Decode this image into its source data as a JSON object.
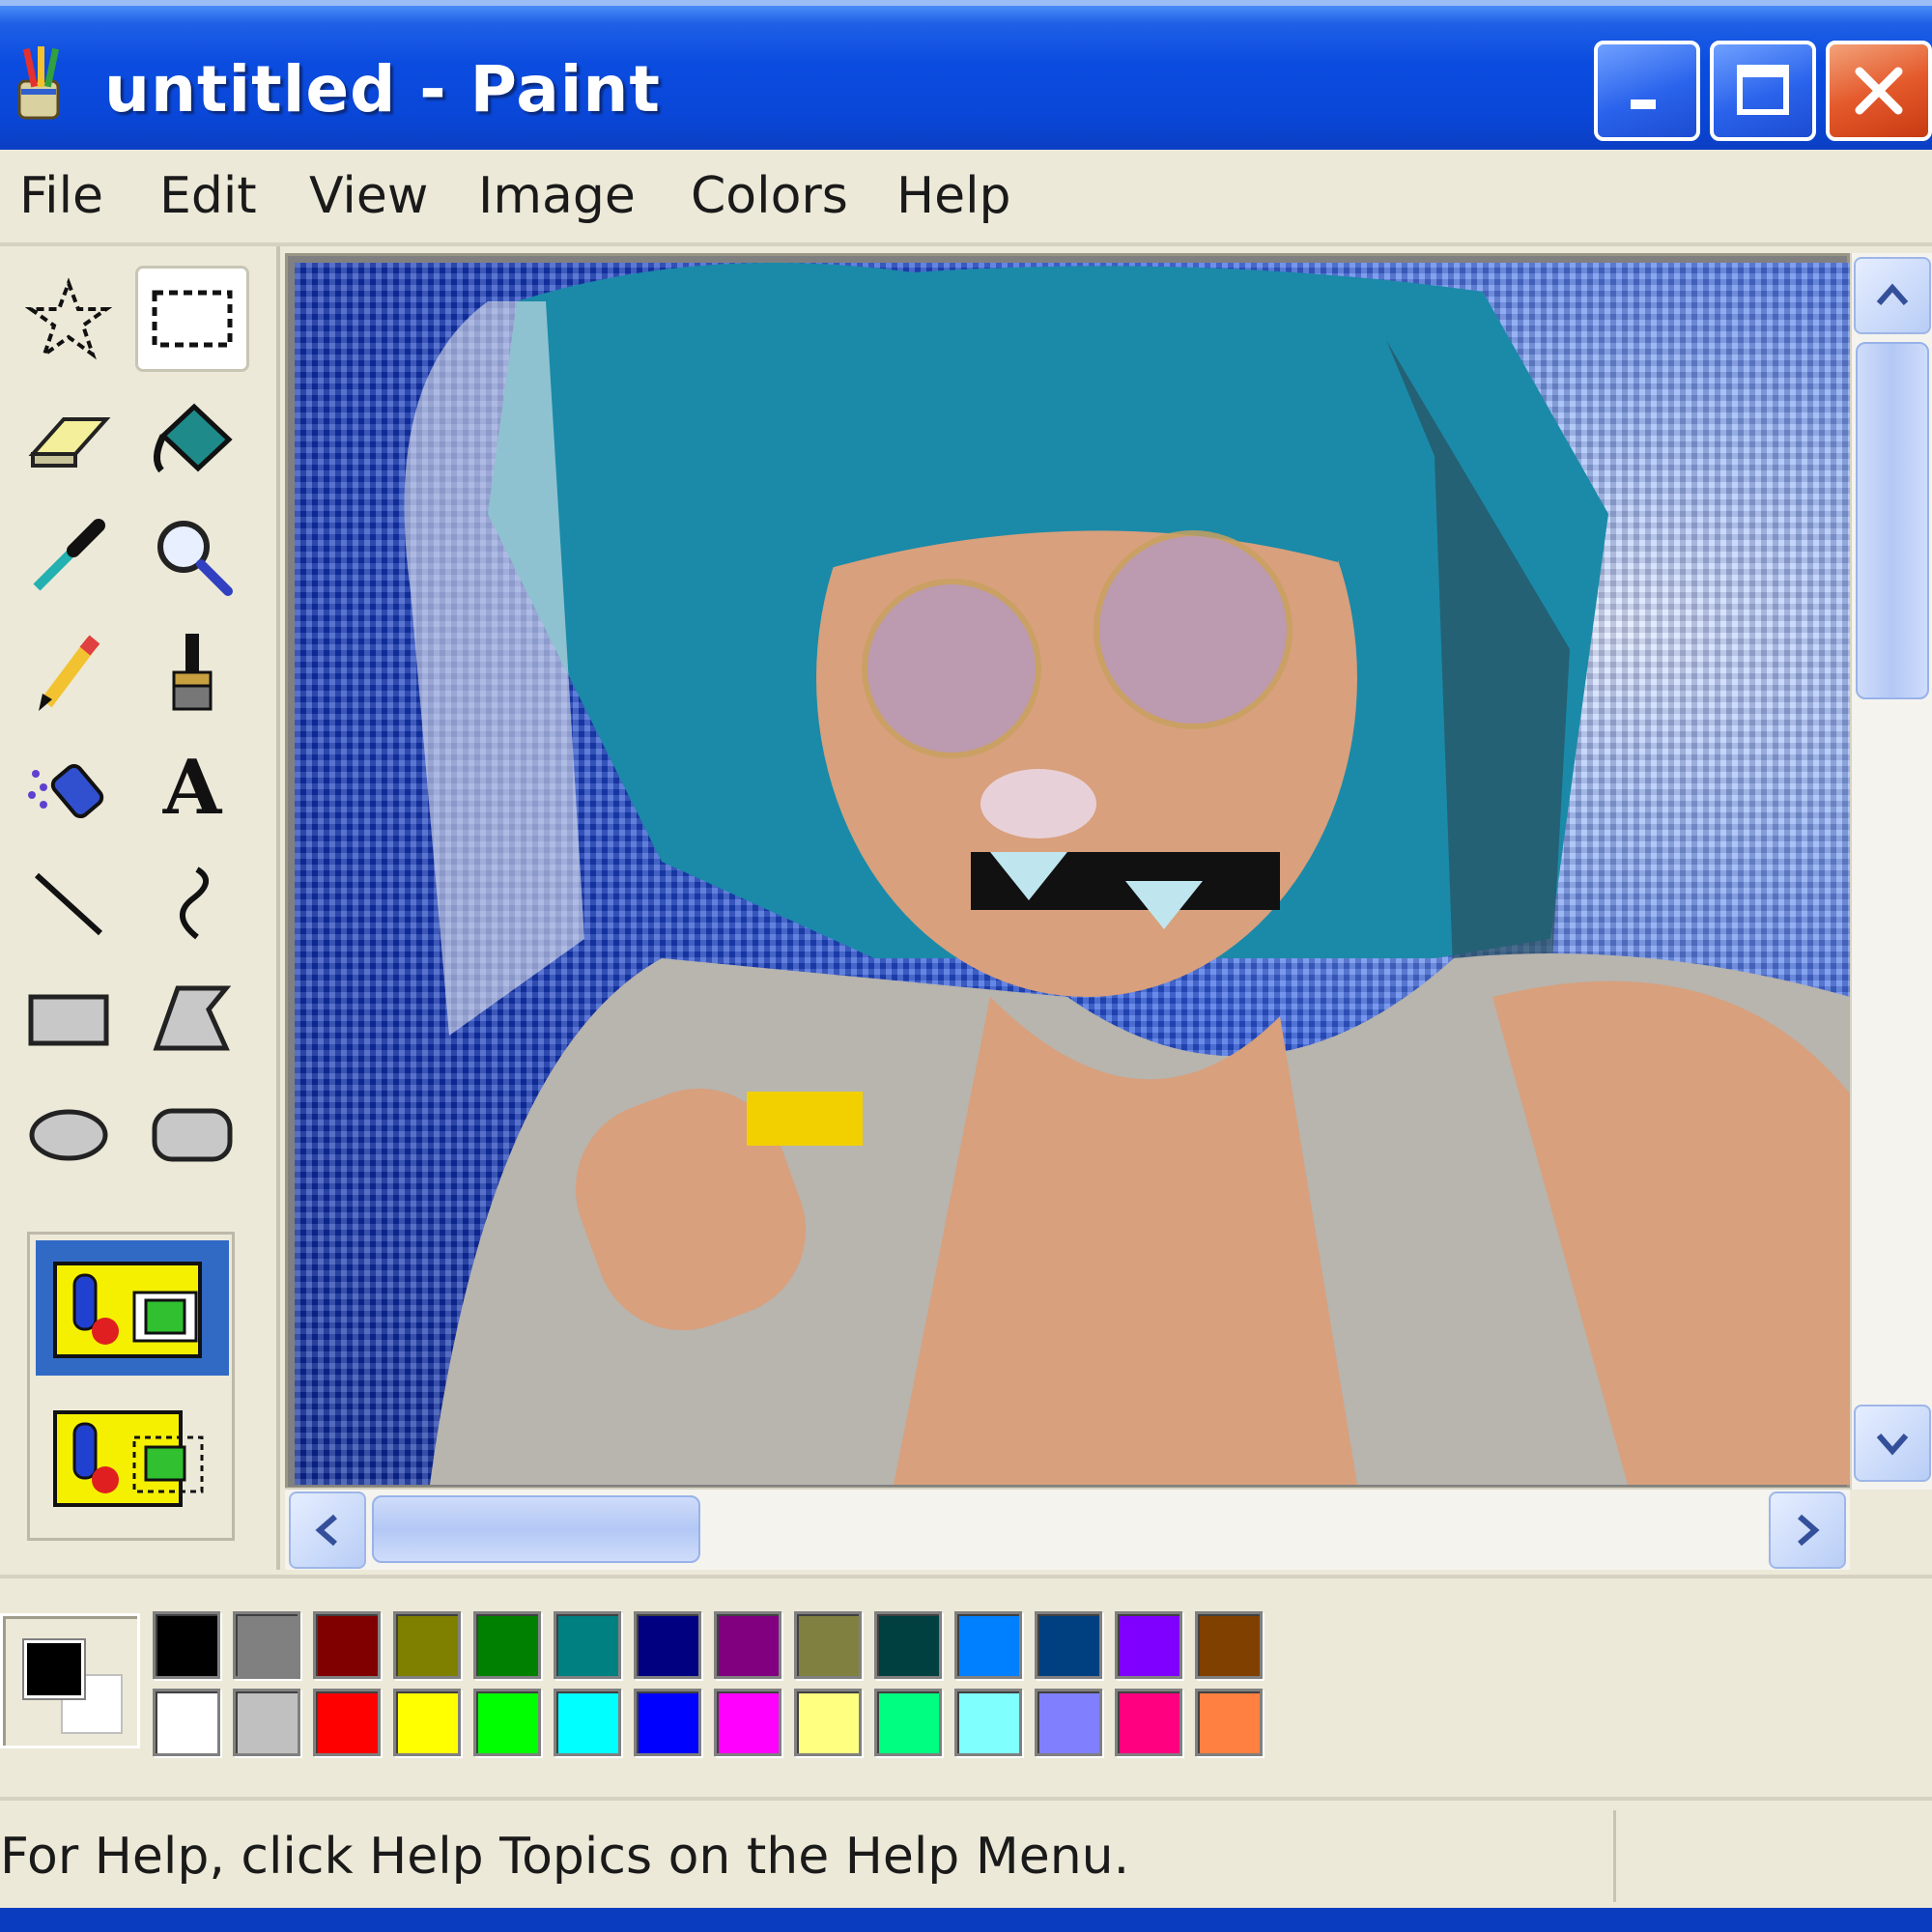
{
  "window": {
    "title": "untitled - Paint",
    "controls": [
      "minimize",
      "maximize",
      "close"
    ]
  },
  "menu": {
    "items": [
      "File",
      "Edit",
      "View",
      "Image",
      "Colors",
      "Help"
    ]
  },
  "toolbox": {
    "tools": [
      {
        "name": "free-form-select",
        "icon": "star-select-icon"
      },
      {
        "name": "select",
        "icon": "rect-select-icon",
        "active": true
      },
      {
        "name": "eraser",
        "icon": "eraser-icon"
      },
      {
        "name": "fill-with-color",
        "icon": "paint-bucket-icon"
      },
      {
        "name": "pick-color",
        "icon": "eyedropper-icon"
      },
      {
        "name": "magnifier",
        "icon": "magnifier-icon"
      },
      {
        "name": "pencil",
        "icon": "pencil-icon"
      },
      {
        "name": "brush",
        "icon": "brush-icon"
      },
      {
        "name": "airbrush",
        "icon": "airbrush-icon"
      },
      {
        "name": "text",
        "icon": "text-icon",
        "glyph": "A"
      },
      {
        "name": "line",
        "icon": "line-icon"
      },
      {
        "name": "curve",
        "icon": "curve-icon"
      },
      {
        "name": "rectangle",
        "icon": "rectangle-icon"
      },
      {
        "name": "polygon",
        "icon": "polygon-icon"
      },
      {
        "name": "ellipse",
        "icon": "ellipse-icon"
      },
      {
        "name": "rounded-rectangle",
        "icon": "rounded-rect-icon"
      }
    ],
    "options": [
      "opaque-selection",
      "transparent-selection"
    ],
    "selected_option": "opaque-selection"
  },
  "canvas": {
    "content": "photo-placeholder"
  },
  "palette": {
    "foreground": "#000000",
    "background": "#ffffff",
    "top_row": [
      "#000000",
      "#808080",
      "#800000",
      "#808000",
      "#008000",
      "#008080",
      "#000080",
      "#800080",
      "#808040",
      "#004040",
      "#0080ff",
      "#004080",
      "#8000ff",
      "#804000"
    ],
    "bottom_row": [
      "#ffffff",
      "#c0c0c0",
      "#ff0000",
      "#ffff00",
      "#00ff00",
      "#00ffff",
      "#0000ff",
      "#ff00ff",
      "#ffff80",
      "#00ff80",
      "#80ffff",
      "#8080ff",
      "#ff0080",
      "#ff8040"
    ]
  },
  "status": {
    "text": "For Help, click Help Topics on the Help Menu."
  },
  "colors": {
    "title_bar": "#0a47d8",
    "chrome": "#ece9d8",
    "close_button": "#e45a2c",
    "selection": "#316ac5"
  }
}
